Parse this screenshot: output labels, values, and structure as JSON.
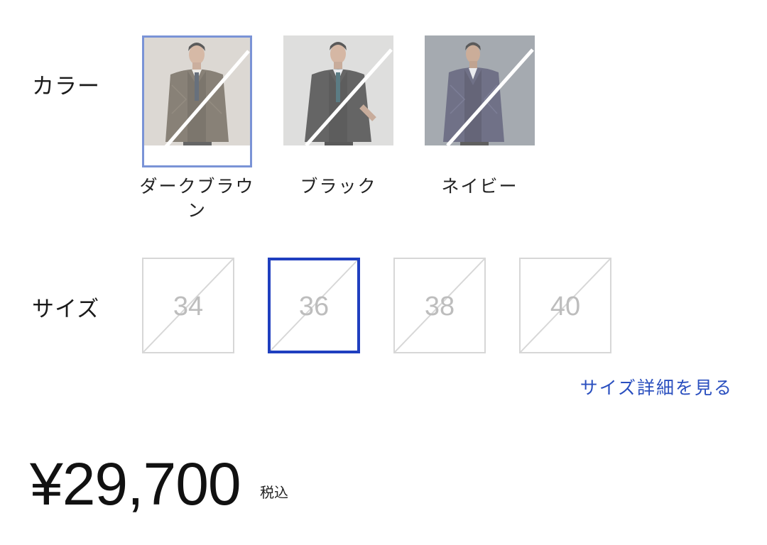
{
  "color": {
    "label": "カラー",
    "swatches": [
      {
        "name": "ダークブラウン",
        "selected": true
      },
      {
        "name": "ブラック",
        "selected": false
      },
      {
        "name": "ネイビー",
        "selected": false
      }
    ]
  },
  "size": {
    "label": "サイズ",
    "options": [
      {
        "value": "34",
        "selected": false
      },
      {
        "value": "36",
        "selected": true
      },
      {
        "value": "38",
        "selected": false
      },
      {
        "value": "40",
        "selected": false
      }
    ],
    "detail_link": "サイズ詳細を見る"
  },
  "price": {
    "amount": "¥29,700",
    "tax_note": "税込"
  },
  "colors": {
    "selected_color_border": "#7a93d6",
    "selected_size_border": "#1f3fbf",
    "link": "#2a4fbf",
    "unavailable_border": "#d7d7d7"
  }
}
